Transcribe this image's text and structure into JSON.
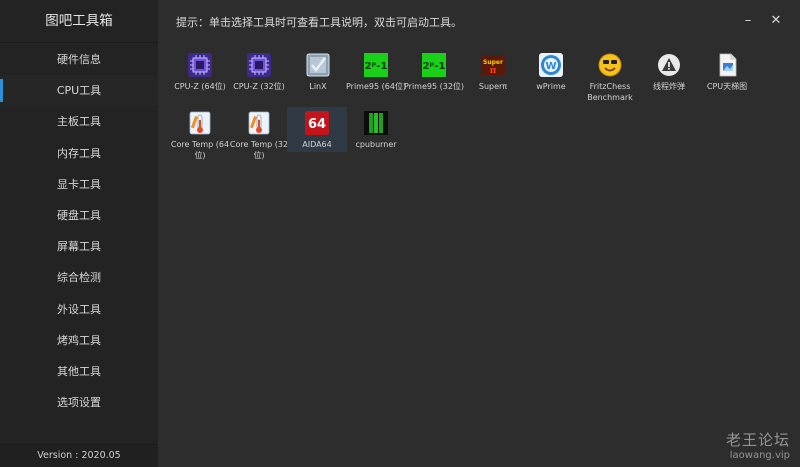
{
  "app": {
    "title": "图吧工具箱",
    "version": "Version : 2020.05"
  },
  "header": {
    "hint": "提示：单击选择工具时可查看工具说明，双击可启动工具。",
    "minimize_icon": "minimize-icon",
    "close_icon": "close-icon"
  },
  "sidebar": {
    "items": [
      {
        "label": "硬件信息"
      },
      {
        "label": "CPU工具",
        "active": true
      },
      {
        "label": "主板工具"
      },
      {
        "label": "内存工具"
      },
      {
        "label": "显卡工具"
      },
      {
        "label": "硬盘工具"
      },
      {
        "label": "屏幕工具"
      },
      {
        "label": "综合检测"
      },
      {
        "label": "外设工具"
      },
      {
        "label": "烤鸡工具"
      },
      {
        "label": "其他工具"
      },
      {
        "label": "选项设置"
      }
    ]
  },
  "tools": [
    {
      "label": "CPU-Z (64位)",
      "icon": "cpuz-icon"
    },
    {
      "label": "CPU-Z (32位)",
      "icon": "cpuz-icon"
    },
    {
      "label": "LinX",
      "icon": "linx-icon"
    },
    {
      "label": "Prime95 (64位)",
      "icon": "prime95-icon"
    },
    {
      "label": "Prime95 (32位)",
      "icon": "prime95-icon"
    },
    {
      "label": "Superπ",
      "icon": "superpi-icon"
    },
    {
      "label": "wPrime",
      "icon": "wprime-icon"
    },
    {
      "label": "FritzChess Benchmark",
      "icon": "fritzchess-icon"
    },
    {
      "label": "线程炸弹",
      "icon": "warning-icon"
    },
    {
      "label": "CPU天梯图",
      "icon": "document-icon"
    },
    {
      "label": "Core Temp (64位)",
      "icon": "coretemp-icon"
    },
    {
      "label": "Core Temp (32位)",
      "icon": "coretemp-icon"
    },
    {
      "label": "AIDA64",
      "icon": "aida64-icon",
      "icon_text": "64",
      "selected": true
    },
    {
      "label": "cpuburner",
      "icon": "cpuburner-icon"
    }
  ],
  "icon_glyphs": {
    "cpuz": "▣",
    "linx": "✓",
    "prime95": "2⁰-1",
    "superpi": "π",
    "wprime": "W",
    "fritzchess": "☻",
    "warning": "!",
    "coretemp": "▮",
    "cpuburner": "▮▮"
  },
  "colors": {
    "sidebar_bg": "#232323",
    "main_bg": "#2d2d2d",
    "accent": "#2f8fd8",
    "selected_bg": "#2f3a45"
  },
  "watermark": {
    "line1": "老王论坛",
    "line2": "laowang.vip"
  }
}
